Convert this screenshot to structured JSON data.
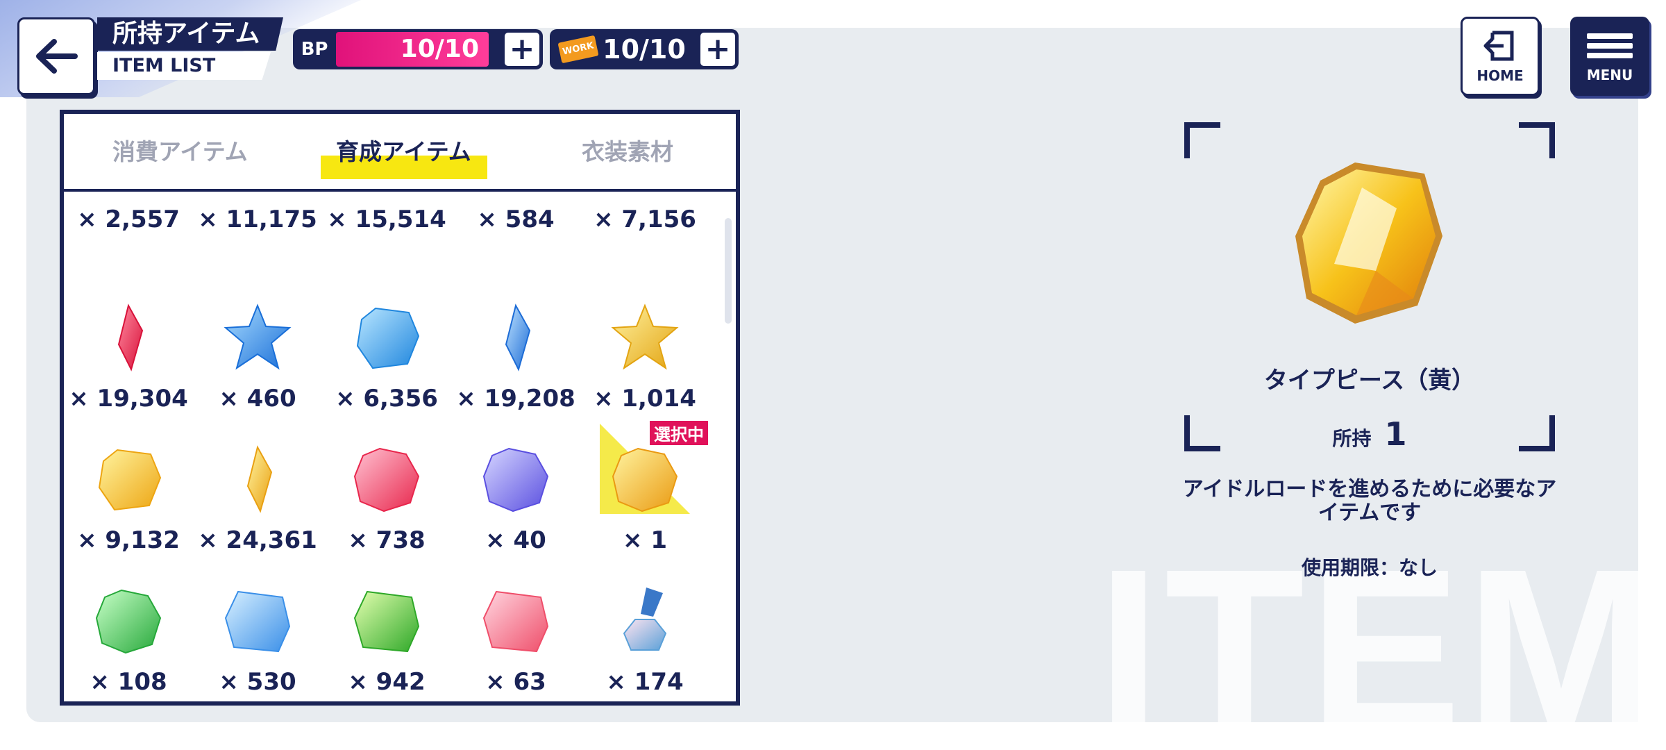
{
  "header": {
    "title_jp": "所持アイテム",
    "title_en": "ITEM LIST",
    "bp_label": "BP",
    "bp_value": "10/10",
    "work_label": "WORK",
    "work_value": "10/10",
    "plus": "+",
    "home_label": "HOME",
    "menu_label": "MENU"
  },
  "tabs": [
    {
      "label": "消費アイテム",
      "active": false
    },
    {
      "label": "育成アイテム",
      "active": true
    },
    {
      "label": "衣装素材",
      "active": false
    }
  ],
  "colors": {
    "navy": "#1a2356",
    "bp_pink": "#e0127a",
    "tab_highlight": "#f7e711",
    "selected_badge": "#e0125a"
  },
  "items": [
    {
      "count": "× 2,557",
      "icon": "partial-row"
    },
    {
      "count": "× 11,175",
      "icon": "partial-row"
    },
    {
      "count": "× 15,514",
      "icon": "partial-row"
    },
    {
      "count": "× 584",
      "icon": "partial-row"
    },
    {
      "count": "× 7,156",
      "icon": "partial-row"
    },
    {
      "count": "× 19,304",
      "icon": "red-crystal-shard-icon"
    },
    {
      "count": "× 460",
      "icon": "blue-star-crystal-icon"
    },
    {
      "count": "× 6,356",
      "icon": "blue-gem-icon"
    },
    {
      "count": "× 19,208",
      "icon": "blue-crystal-shard-icon"
    },
    {
      "count": "× 1,014",
      "icon": "gold-star-crystal-icon"
    },
    {
      "count": "× 9,132",
      "icon": "yellow-gem-icon"
    },
    {
      "count": "× 24,361",
      "icon": "yellow-crystal-shard-icon"
    },
    {
      "count": "× 738",
      "icon": "red-star-gem-icon"
    },
    {
      "count": "× 40",
      "icon": "purple-gem-icon"
    },
    {
      "count": "× 1",
      "icon": "yellow-type-piece-icon",
      "selected": true
    },
    {
      "count": "× 108",
      "icon": "green-gem-icon"
    },
    {
      "count": "× 530",
      "icon": "rainbow-star-card-icon"
    },
    {
      "count": "× 942",
      "icon": "green-heart-gem-icon"
    },
    {
      "count": "× 63",
      "icon": "music-note-gem-icon"
    },
    {
      "count": "× 174",
      "icon": "flower-medal-icon"
    }
  ],
  "selected_badge": "選択中",
  "detail": {
    "name": "タイプピース（黄）",
    "owned_label": "所持",
    "owned_value": "1",
    "description": "アイドルロードを進めるために必要なアイテムです",
    "expiry": "使用期限：なし",
    "watermark": "ITEM"
  }
}
